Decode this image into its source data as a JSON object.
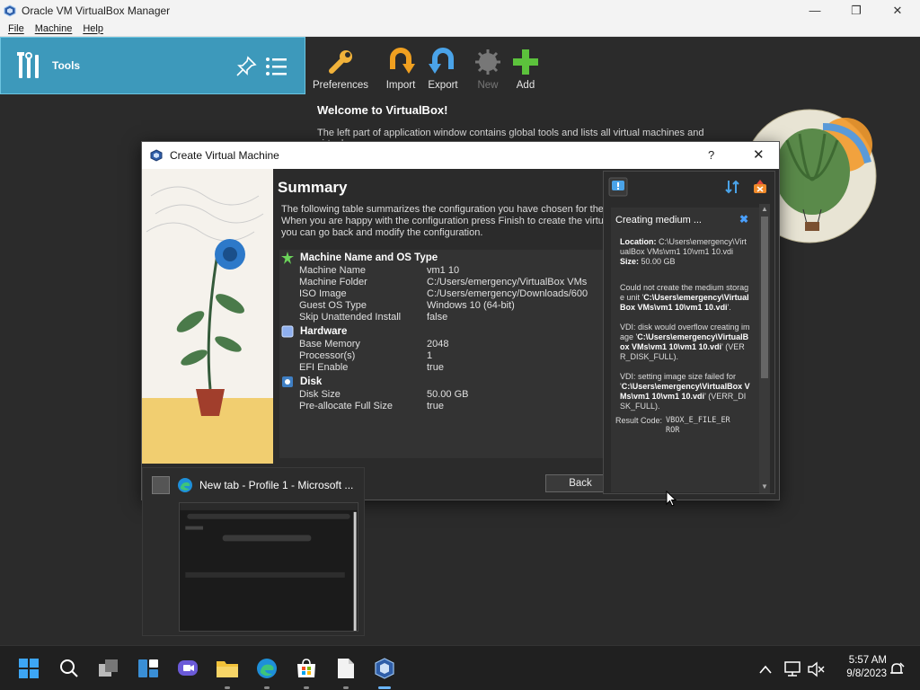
{
  "window": {
    "title": "Oracle VM VirtualBox Manager",
    "minimize": "—",
    "maximize": "❐",
    "close": "✕"
  },
  "menu": [
    "File",
    "Machine",
    "Help"
  ],
  "left": {
    "tools_label": "Tools"
  },
  "toolbar": {
    "preferences": "Preferences",
    "import": "Import",
    "export": "Export",
    "new": "New",
    "add": "Add"
  },
  "welcome": {
    "title": "Welcome to VirtualBox!",
    "text": "The left part of application window contains global tools and lists all virtual machines and virtual"
  },
  "dialog": {
    "title": "Create Virtual Machine",
    "help": "?",
    "close": "✕",
    "summary_title": "Summary",
    "summary_lines": [
      "The following table summarizes the configuration you have chosen for the",
      "When you are happy with the configuration press Finish to create the virtu",
      "you can go back and modify the configuration."
    ],
    "sections": [
      {
        "title": "Machine Name and OS Type",
        "rows": [
          {
            "k": "Machine Name",
            "v": "vm1 10"
          },
          {
            "k": "Machine Folder",
            "v": "C:/Users/emergency/VirtualBox VMs"
          },
          {
            "k": "ISO Image",
            "v": "C:/Users/emergency/Downloads/600"
          },
          {
            "k": "Guest OS Type",
            "v": "Windows 10 (64-bit)"
          },
          {
            "k": "Skip Unattended Install",
            "v": "false"
          }
        ]
      },
      {
        "title": "Hardware",
        "rows": [
          {
            "k": "Base Memory",
            "v": "2048"
          },
          {
            "k": "Processor(s)",
            "v": "1"
          },
          {
            "k": "EFI Enable",
            "v": "true"
          }
        ]
      },
      {
        "title": "Disk",
        "rows": [
          {
            "k": "Disk Size",
            "v": "50.00 GB"
          },
          {
            "k": "Pre-allocate Full Size",
            "v": "true"
          }
        ]
      }
    ],
    "back_button": "Back"
  },
  "notification": {
    "heading": "Creating medium ...",
    "location_label": "Location:",
    "location_value": "C:\\Users\\emergency\\VirtualBox VMs\\vm1 10\\vm1 10.vdi",
    "size_label": "Size:",
    "size_value": "50.00 GB",
    "msg1_text": "Could not create the medium storage unit '",
    "msg1_path": "C:\\Users\\emergency\\VirtualBox VMs\\vm1 10\\vm1 10.vdi",
    "msg1_end": "'.",
    "msg2_text": "VDI: disk would overflow creating image '",
    "msg2_path": "C:\\Users\\emergency\\VirtualBox VMs\\vm1 10\\vm1 10.vdi",
    "msg2_end": "' (VERR_DISK_FULL).",
    "msg3_text": "VDI: setting image size failed for '",
    "msg3_path": "C:\\Users\\emergency\\VirtualBox VMs\\vm1 10\\vm1 10.vdi",
    "msg3_end": "' (VERR_DISK_FULL).",
    "result_label": "Result Code:",
    "result_value": "VBOX_E_FILE_ERROR"
  },
  "thumbnail": {
    "title": "New tab - Profile 1 - Microsoft ..."
  },
  "clock": {
    "time": "5:57 AM",
    "date": "9/8/2023"
  }
}
